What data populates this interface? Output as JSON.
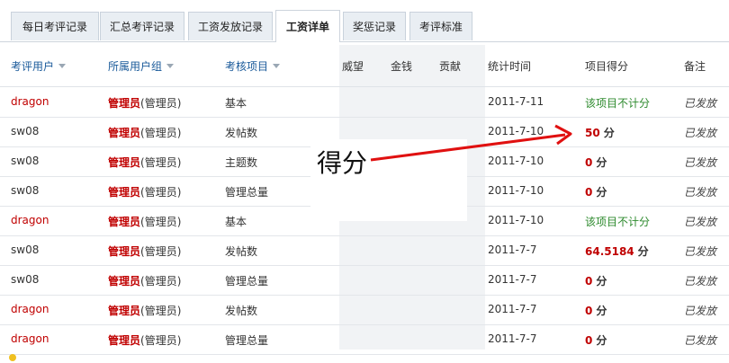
{
  "tabs": [
    {
      "label": "每日考评记录",
      "active": false
    },
    {
      "label": "汇总考评记录",
      "active": false
    },
    {
      "label": "工资发放记录",
      "active": false
    },
    {
      "label": "工资详单",
      "active": true
    },
    {
      "label": "奖惩记录",
      "active": false
    },
    {
      "label": "考评标准",
      "active": false
    }
  ],
  "table": {
    "headers": {
      "user": "考评用户",
      "group": "所属用户组",
      "item": "考核项目",
      "prestige": "威望",
      "money": "金钱",
      "contribution": "贡献",
      "time": "统计时间",
      "score": "项目得分",
      "note": "备注"
    },
    "rows": [
      {
        "user": "dragon",
        "group_name": "管理员",
        "group_sub": "(管理员)",
        "item": "基本",
        "time": "2011-7-11",
        "score": "该项目不计分",
        "unit": "",
        "note": "已发放"
      },
      {
        "user": "sw08",
        "group_name": "管理员",
        "group_sub": "(管理员)",
        "item": "发帖数",
        "time": "2011-7-10",
        "score": "50",
        "unit": "分",
        "note": "已发放"
      },
      {
        "user": "sw08",
        "group_name": "管理员",
        "group_sub": "(管理员)",
        "item": "主题数",
        "time": "2011-7-10",
        "score": "0",
        "unit": "分",
        "note": "已发放"
      },
      {
        "user": "sw08",
        "group_name": "管理员",
        "group_sub": "(管理员)",
        "item": "管理总量",
        "time": "2011-7-10",
        "score": "0",
        "unit": "分",
        "note": "已发放"
      },
      {
        "user": "dragon",
        "group_name": "管理员",
        "group_sub": "(管理员)",
        "item": "基本",
        "time": "2011-7-10",
        "score": "该项目不计分",
        "unit": "",
        "note": "已发放"
      },
      {
        "user": "sw08",
        "group_name": "管理员",
        "group_sub": "(管理员)",
        "item": "发帖数",
        "time": "2011-7-7",
        "score": "64.5184",
        "unit": "分",
        "note": "已发放"
      },
      {
        "user": "sw08",
        "group_name": "管理员",
        "group_sub": "(管理员)",
        "item": "管理总量",
        "time": "2011-7-7",
        "score": "0",
        "unit": "分",
        "note": "已发放"
      },
      {
        "user": "dragon",
        "group_name": "管理员",
        "group_sub": "(管理员)",
        "item": "发帖数",
        "time": "2011-7-7",
        "score": "0",
        "unit": "分",
        "note": "已发放"
      },
      {
        "user": "dragon",
        "group_name": "管理员",
        "group_sub": "(管理员)",
        "item": "管理总量",
        "time": "2011-7-7",
        "score": "0",
        "unit": "分",
        "note": "已发放"
      }
    ]
  },
  "annotation": {
    "label": "得分"
  },
  "colors": {
    "accent_red": "#c00000",
    "link_blue": "#1a5a9a",
    "nocount_green": "#2d8a2d",
    "arrow_red": "#e01010"
  },
  "icons": {
    "footer_bullet": "info-bullet-icon",
    "sort": "sort-down-arrow-icon"
  }
}
